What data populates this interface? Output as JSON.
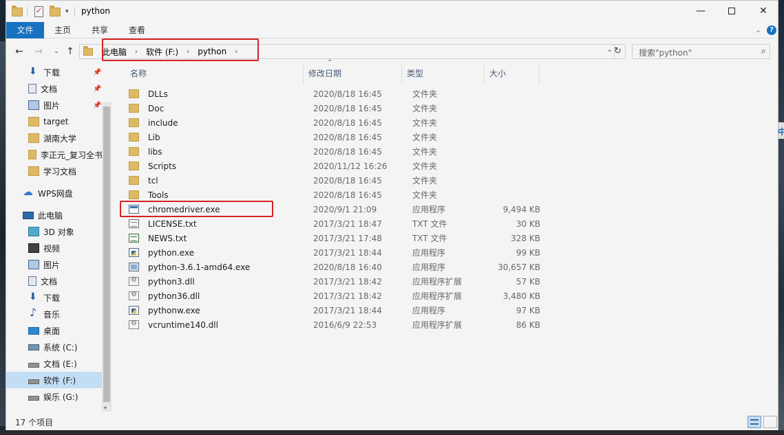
{
  "window": {
    "title": "python"
  },
  "ribbon": {
    "tabs": [
      "文件",
      "主页",
      "共享",
      "查看"
    ]
  },
  "nav": {
    "breadcrumb": [
      "此电脑",
      "软件 (F:)",
      "python"
    ],
    "search_placeholder": "搜索\"python\""
  },
  "sidebar": {
    "items": [
      {
        "label": "下载",
        "icon": "download-icon",
        "pinned": true
      },
      {
        "label": "文档",
        "icon": "document-icon",
        "pinned": true
      },
      {
        "label": "图片",
        "icon": "picture-icon",
        "pinned": true
      },
      {
        "label": "target",
        "icon": "folder-icon"
      },
      {
        "label": "湖南大学",
        "icon": "folder-icon"
      },
      {
        "label": "李正元_复习全书",
        "icon": "folder-icon"
      },
      {
        "label": "学习文档",
        "icon": "folder-icon"
      },
      {
        "label": "WPS网盘",
        "icon": "cloud-icon"
      },
      {
        "label": "此电脑",
        "icon": "computer-icon"
      },
      {
        "label": "3D 对象",
        "icon": "cube-icon"
      },
      {
        "label": "视频",
        "icon": "video-icon"
      },
      {
        "label": "图片",
        "icon": "picture-icon"
      },
      {
        "label": "文档",
        "icon": "document-icon"
      },
      {
        "label": "下载",
        "icon": "download-icon"
      },
      {
        "label": "音乐",
        "icon": "music-icon"
      },
      {
        "label": "桌面",
        "icon": "desktop-icon"
      },
      {
        "label": "系统 (C:)",
        "icon": "system-drive-icon"
      },
      {
        "label": "文档 (E:)",
        "icon": "drive-icon"
      },
      {
        "label": "软件 (F:)",
        "icon": "drive-icon",
        "selected": true
      },
      {
        "label": "娱乐 (G:)",
        "icon": "drive-icon"
      }
    ]
  },
  "columns": {
    "name": "名称",
    "date": "修改日期",
    "type": "类型",
    "size": "大小"
  },
  "files": [
    {
      "name": "DLLs",
      "date": "2020/8/18 16:45",
      "type": "文件夹",
      "size": "",
      "icon": "folder-icon"
    },
    {
      "name": "Doc",
      "date": "2020/8/18 16:45",
      "type": "文件夹",
      "size": "",
      "icon": "folder-icon"
    },
    {
      "name": "include",
      "date": "2020/8/18 16:45",
      "type": "文件夹",
      "size": "",
      "icon": "folder-icon"
    },
    {
      "name": "Lib",
      "date": "2020/8/18 16:45",
      "type": "文件夹",
      "size": "",
      "icon": "folder-icon"
    },
    {
      "name": "libs",
      "date": "2020/8/18 16:45",
      "type": "文件夹",
      "size": "",
      "icon": "folder-icon"
    },
    {
      "name": "Scripts",
      "date": "2020/11/12 16:26",
      "type": "文件夹",
      "size": "",
      "icon": "folder-icon"
    },
    {
      "name": "tcl",
      "date": "2020/8/18 16:45",
      "type": "文件夹",
      "size": "",
      "icon": "folder-icon"
    },
    {
      "name": "Tools",
      "date": "2020/8/18 16:45",
      "type": "文件夹",
      "size": "",
      "icon": "folder-icon"
    },
    {
      "name": "chromedriver.exe",
      "date": "2020/9/1 21:09",
      "type": "应用程序",
      "size": "9,494 KB",
      "icon": "exe-icon"
    },
    {
      "name": "LICENSE.txt",
      "date": "2017/3/21 18:47",
      "type": "TXT 文件",
      "size": "30 KB",
      "icon": "text-file-icon"
    },
    {
      "name": "NEWS.txt",
      "date": "2017/3/21 17:48",
      "type": "TXT 文件",
      "size": "328 KB",
      "icon": "text-file-green-icon"
    },
    {
      "name": "python.exe",
      "date": "2017/3/21 18:44",
      "type": "应用程序",
      "size": "99 KB",
      "icon": "python-icon"
    },
    {
      "name": "python-3.6.1-amd64.exe",
      "date": "2020/8/18 16:40",
      "type": "应用程序",
      "size": "30,657 KB",
      "icon": "installer-icon"
    },
    {
      "name": "python3.dll",
      "date": "2017/3/21 18:42",
      "type": "应用程序扩展",
      "size": "57 KB",
      "icon": "dll-icon"
    },
    {
      "name": "python36.dll",
      "date": "2017/3/21 18:42",
      "type": "应用程序扩展",
      "size": "3,480 KB",
      "icon": "dll-icon"
    },
    {
      "name": "pythonw.exe",
      "date": "2017/3/21 18:44",
      "type": "应用程序",
      "size": "97 KB",
      "icon": "python-icon"
    },
    {
      "name": "vcruntime140.dll",
      "date": "2016/6/9 22:53",
      "type": "应用程序扩展",
      "size": "86 KB",
      "icon": "dll-icon"
    }
  ],
  "status": {
    "item_count": "17 个项目"
  },
  "colors": {
    "accent": "#1979ca",
    "highlight": "#e02424",
    "selection": "#cce8ff"
  }
}
